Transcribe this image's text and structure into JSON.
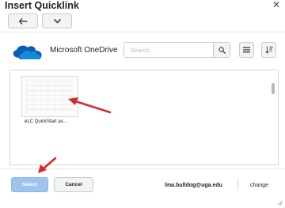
{
  "dialog": {
    "title": "Insert Quicklink",
    "close_glyph": "✕"
  },
  "nav": {
    "back_icon": "arrow-left-icon",
    "menu_icon": "chevron-down-icon"
  },
  "provider": {
    "name": "Microsoft OneDrive",
    "logo_icon": "onedrive-cloud-icon",
    "logo_color": "#0a5fb4"
  },
  "search": {
    "placeholder": "Search...",
    "value": "",
    "button_icon": "search-icon"
  },
  "toolbar": {
    "view_icon": "list-view-icon",
    "sort_icon": "sort-icon"
  },
  "files": [
    {
      "name": "eLC QuickStart as..."
    }
  ],
  "footer": {
    "select_label": "Select",
    "cancel_label": "Cancel",
    "account": "lma.bulldog@uga.edu",
    "change_label": "change"
  },
  "colors": {
    "annotation_arrow": "#d62a2a",
    "select_button": "#9dc4ec",
    "text": "#202122"
  }
}
